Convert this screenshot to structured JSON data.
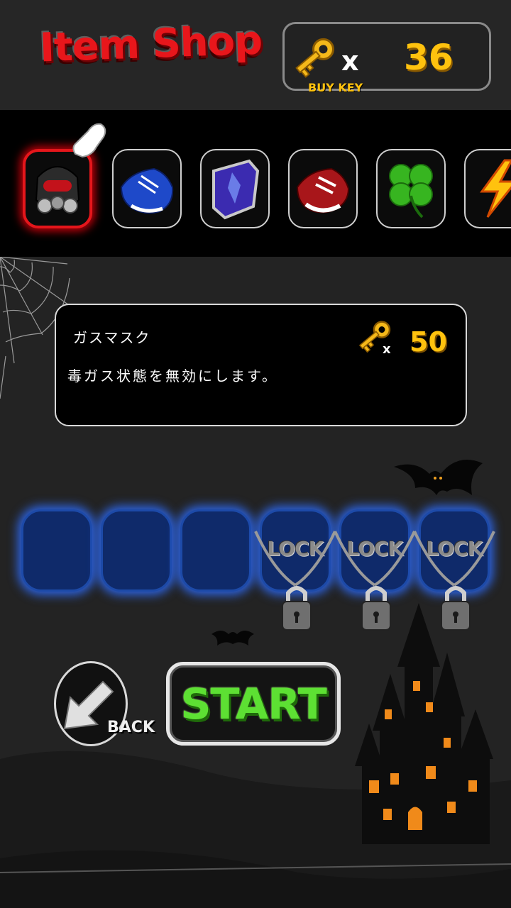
{
  "header": {
    "title": "Item Shop",
    "key_multiplier": "x",
    "key_count": "36",
    "buy_key_label": "BUY KEY"
  },
  "item_strip": {
    "items": [
      {
        "icon": "gas-mask-icon",
        "selected": true
      },
      {
        "icon": "blue-sneaker-icon",
        "selected": false
      },
      {
        "icon": "shield-icon",
        "selected": false
      },
      {
        "icon": "red-sneaker-icon",
        "selected": false
      },
      {
        "icon": "four-leaf-clover-icon",
        "selected": false
      },
      {
        "icon": "lightning-icon",
        "selected": false
      }
    ]
  },
  "description": {
    "item_name": "ガスマスク",
    "item_desc": "毒ガス状態を無効にします。",
    "price_multiplier": "x",
    "price": "50"
  },
  "equip_slots": [
    {
      "locked": false,
      "label": ""
    },
    {
      "locked": false,
      "label": ""
    },
    {
      "locked": false,
      "label": ""
    },
    {
      "locked": true,
      "label": "LOCK"
    },
    {
      "locked": true,
      "label": "LOCK"
    },
    {
      "locked": true,
      "label": "LOCK"
    }
  ],
  "buttons": {
    "back_label": "BACK",
    "start_label": "START"
  },
  "colors": {
    "title_red": "#e8161b",
    "key_gold": "#ffc20e",
    "start_green": "#5de033",
    "slot_blue": "#0f2a6a"
  }
}
